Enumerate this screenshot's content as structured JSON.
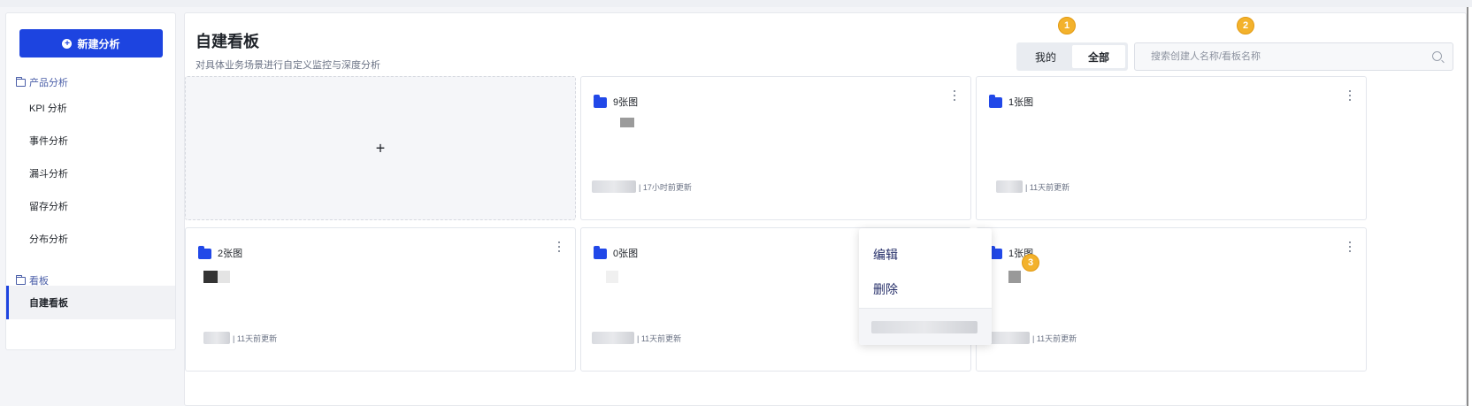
{
  "sidebar": {
    "new_button": "新建分析",
    "group_product": "产品分析",
    "items": [
      {
        "label": "KPI 分析"
      },
      {
        "label": "事件分析"
      },
      {
        "label": "漏斗分析"
      },
      {
        "label": "留存分析"
      },
      {
        "label": "分布分析"
      }
    ],
    "group_board": "看板",
    "board_items": [
      {
        "label": "自建看板",
        "active": true
      }
    ]
  },
  "header": {
    "title": "自建看板",
    "subtitle": "对具体业务场景进行自定义监控与深度分析",
    "scope_options": [
      "我的",
      "全部"
    ],
    "scope_selected": "全部",
    "search_placeholder": "搜索创建人名称/看板名称"
  },
  "badges": [
    "1",
    "2",
    "3"
  ],
  "add_card": {
    "icon": "+"
  },
  "cards": [
    {
      "chart_count": "9张图",
      "updated": "| 17小时前更新"
    },
    {
      "chart_count": "1张图",
      "updated": "| 11天前更新"
    },
    {
      "chart_count": "2张图",
      "updated": "| 11天前更新"
    },
    {
      "chart_count": "0张图",
      "updated": "| 11天前更新"
    },
    {
      "chart_count": "1张图",
      "updated": "| 11天前更新"
    }
  ],
  "context_menu": {
    "items": [
      "编辑",
      "删除"
    ]
  },
  "colors": {
    "primary": "#1d44e0",
    "folder": "#2148e8",
    "badge": "#f3b22c",
    "menu_text": "#27306a"
  },
  "icons": [
    "plus-circle-icon",
    "folder-outline-icon",
    "search-icon",
    "folder-icon",
    "more-vertical-icon",
    "plus-icon"
  ]
}
